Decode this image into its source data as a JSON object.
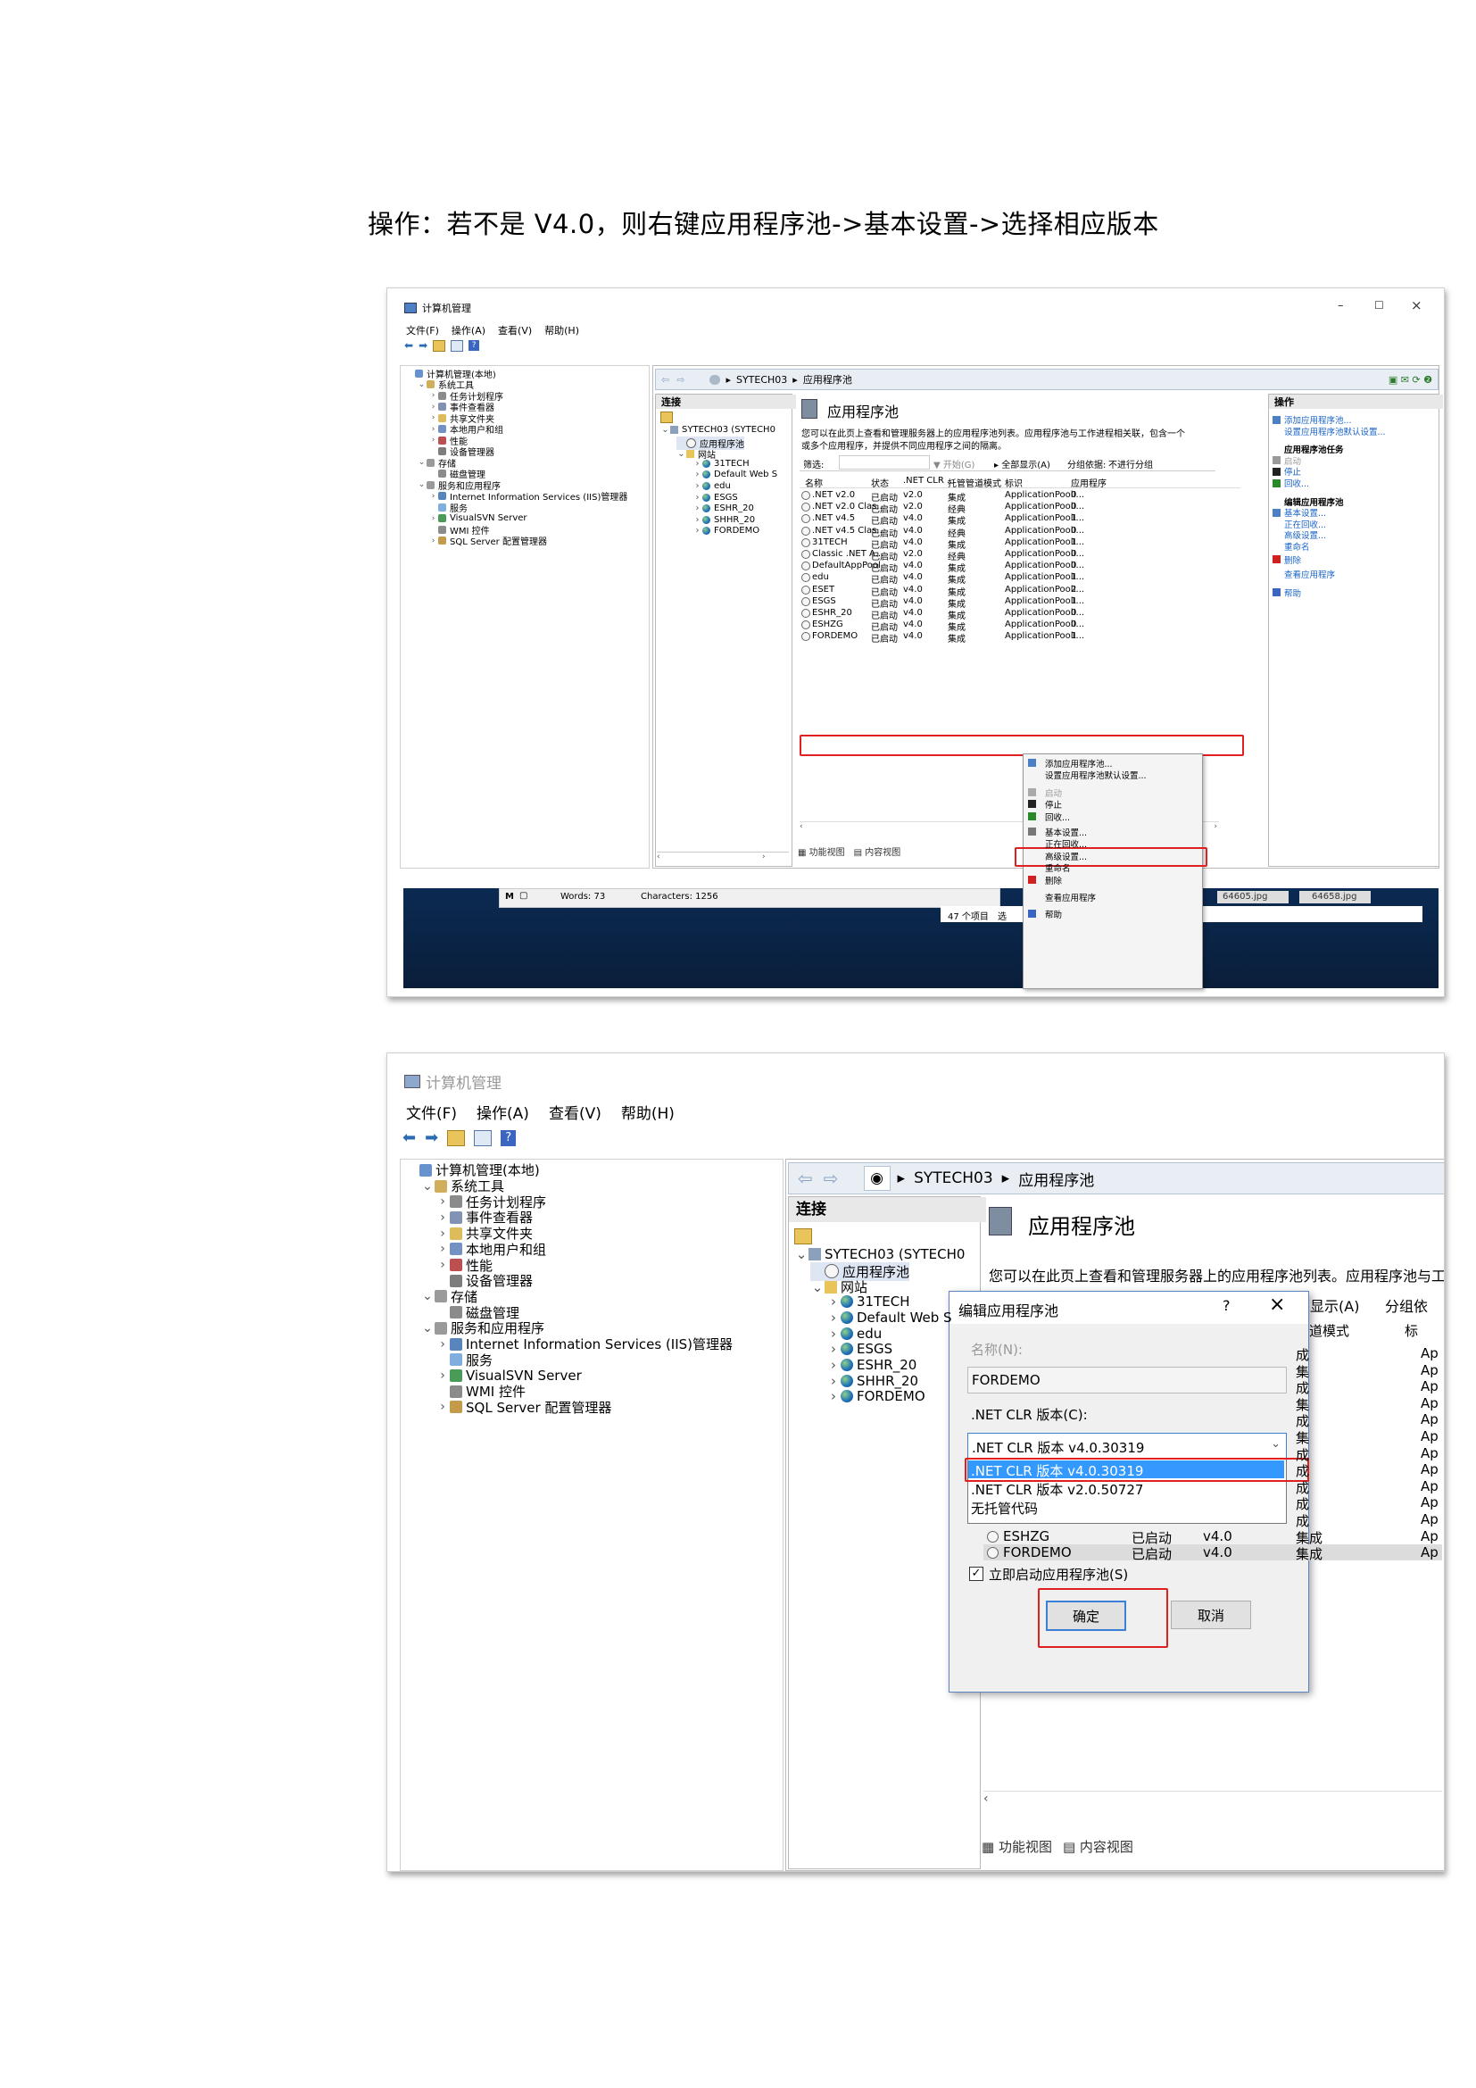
{
  "heading": "操作：若不是 V4.0，则右键应用程序池->基本设置->选择相应版本",
  "window": {
    "title": "计算机管理",
    "menu": [
      "文件(F)",
      "操作(A)",
      "查看(V)",
      "帮助(H)"
    ],
    "controls": [
      "–",
      "☐",
      "×"
    ]
  },
  "tree": {
    "root": "计算机管理(本地)",
    "system_tools": "系统工具",
    "task_scheduler": "任务计划程序",
    "event_viewer": "事件查看器",
    "shared_folders": "共享文件夹",
    "local_users": "本地用户和组",
    "performance": "性能",
    "device_manager": "设备管理器",
    "storage": "存储",
    "disk_management": "磁盘管理",
    "services_apps": "服务和应用程序",
    "iis": "Internet Information Services (IIS)管理器",
    "services": "服务",
    "visualsvn": "VisualSVN Server",
    "wmi": "WMI 控件",
    "sql": "SQL Server 配置管理器"
  },
  "iis": {
    "breadcrumb": [
      "SYTECH03",
      "应用程序池"
    ],
    "connections_header": "连接",
    "server_node": "SYTECH03 (SYTECH0",
    "pools_node": "应用程序池",
    "sites_node": "网站",
    "sites": [
      "31TECH",
      "Default Web S",
      "edu",
      "ESGS",
      "ESHR_20",
      "SHHR_20",
      "FORDEMO"
    ],
    "page_title": "应用程序池",
    "description_1": "您可以在此页上查看和管理服务器上的应用程序池列表。应用程序池与工作进程相关联，包含一个",
    "description_2": "或多个应用程序，并提供不同应用程序之间的隔离。",
    "description_short": "您可以在此页上查看和管理服务器上的应用程序池列表。应用程序池与工",
    "filter_label": "筛选:",
    "filter_start": "开始(G)",
    "filter_show_all": "全部显示(A)",
    "filter_group_label": "分组依据:",
    "filter_group_value": "不进行分组",
    "filter_show_all_short": "部显示(A)",
    "filter_group_short": "分组依",
    "columns": [
      "名称",
      "状态",
      ".NET CLR ...",
      "托管管道模式",
      "标识",
      "应用程序"
    ],
    "columns_short": [
      "管道模式",
      "标"
    ],
    "rows": [
      {
        "name": ".NET v2.0",
        "status": "已启动",
        "clr": "v2.0",
        "mode": "集成",
        "identity": "ApplicationPoolI...",
        "apps": "0"
      },
      {
        "name": ".NET v2.0 Clas...",
        "status": "已启动",
        "clr": "v2.0",
        "mode": "经典",
        "identity": "ApplicationPoolI...",
        "apps": "0"
      },
      {
        "name": ".NET v4.5",
        "status": "已启动",
        "clr": "v4.0",
        "mode": "集成",
        "identity": "ApplicationPoolI...",
        "apps": "1"
      },
      {
        "name": ".NET v4.5 Clas...",
        "status": "已启动",
        "clr": "v4.0",
        "mode": "经典",
        "identity": "ApplicationPoolI...",
        "apps": "0"
      },
      {
        "name": "31TECH",
        "status": "已启动",
        "clr": "v4.0",
        "mode": "集成",
        "identity": "ApplicationPoolI...",
        "apps": "1"
      },
      {
        "name": "Classic .NET A...",
        "status": "已启动",
        "clr": "v2.0",
        "mode": "经典",
        "identity": "ApplicationPoolI...",
        "apps": "0"
      },
      {
        "name": "DefaultAppPool",
        "status": "已启动",
        "clr": "v4.0",
        "mode": "集成",
        "identity": "ApplicationPoolI...",
        "apps": "0"
      },
      {
        "name": "edu",
        "status": "已启动",
        "clr": "v4.0",
        "mode": "集成",
        "identity": "ApplicationPoolI...",
        "apps": "1"
      },
      {
        "name": "ESET",
        "status": "已启动",
        "clr": "v4.0",
        "mode": "集成",
        "identity": "ApplicationPoolI...",
        "apps": "2"
      },
      {
        "name": "ESGS",
        "status": "已启动",
        "clr": "v4.0",
        "mode": "集成",
        "identity": "ApplicationPoolI...",
        "apps": "1"
      },
      {
        "name": "ESHR_20",
        "status": "已启动",
        "clr": "v4.0",
        "mode": "集成",
        "identity": "ApplicationPoolI...",
        "apps": "0"
      },
      {
        "name": "ESHZG",
        "status": "已启动",
        "clr": "v4.0",
        "mode": "集成",
        "identity": "ApplicationPoolI...",
        "apps": "0"
      },
      {
        "name": "FORDEMO",
        "status": "已启动",
        "clr": "v4.0",
        "mode": "集成",
        "identity": "ApplicationPoolI...",
        "apps": "1"
      }
    ],
    "row_prefix_short": [
      "Ap"
    ],
    "bottom_tabs": [
      "功能视图",
      "内容视图"
    ]
  },
  "context_menu": [
    "添加应用程序池...",
    "设置应用程序池默认设置...",
    "启动",
    "停止",
    "回收...",
    "基本设置...",
    "正在回收...",
    "高级设置...",
    "重命名",
    "删除",
    "查看应用程序",
    "帮助"
  ],
  "actions": {
    "header": "操作",
    "add_pool": "添加应用程序池...",
    "set_defaults": "设置应用程序池默认设置...",
    "tasks_header": "应用程序池任务",
    "start": "启动",
    "stop": "停止",
    "recycle": "回收...",
    "edit_header": "编辑应用程序池",
    "basic": "基本设置...",
    "recycling": "正在回收...",
    "advanced": "高级设置...",
    "rename": "重命名",
    "delete": "删除",
    "view_apps": "查看应用程序",
    "help": "帮助"
  },
  "taskbar": {
    "words": "Words: 73",
    "characters": "Characters: 1256",
    "items_count": "47 个项目",
    "selected": "选",
    "thumb1": "64605.jpg",
    "thumb2": "64658.jpg"
  },
  "dialog": {
    "title": "编辑应用程序池",
    "help": "?",
    "close": "×",
    "name_label": "名称(N):",
    "name_value": "FORDEMO",
    "clr_label": ".NET CLR 版本(C):",
    "clr_selected": ".NET CLR 版本 v4.0.30319",
    "options": [
      ".NET CLR 版本 v4.0.30319",
      ".NET CLR 版本 v2.0.50727",
      "无托管代码"
    ],
    "checkbox_label": "立即启动应用程序池(S)",
    "ok": "确定",
    "cancel": "取消"
  },
  "colors": {
    "highlight": "#e02020",
    "selection": "#3399ff",
    "link": "#1a64c8"
  }
}
